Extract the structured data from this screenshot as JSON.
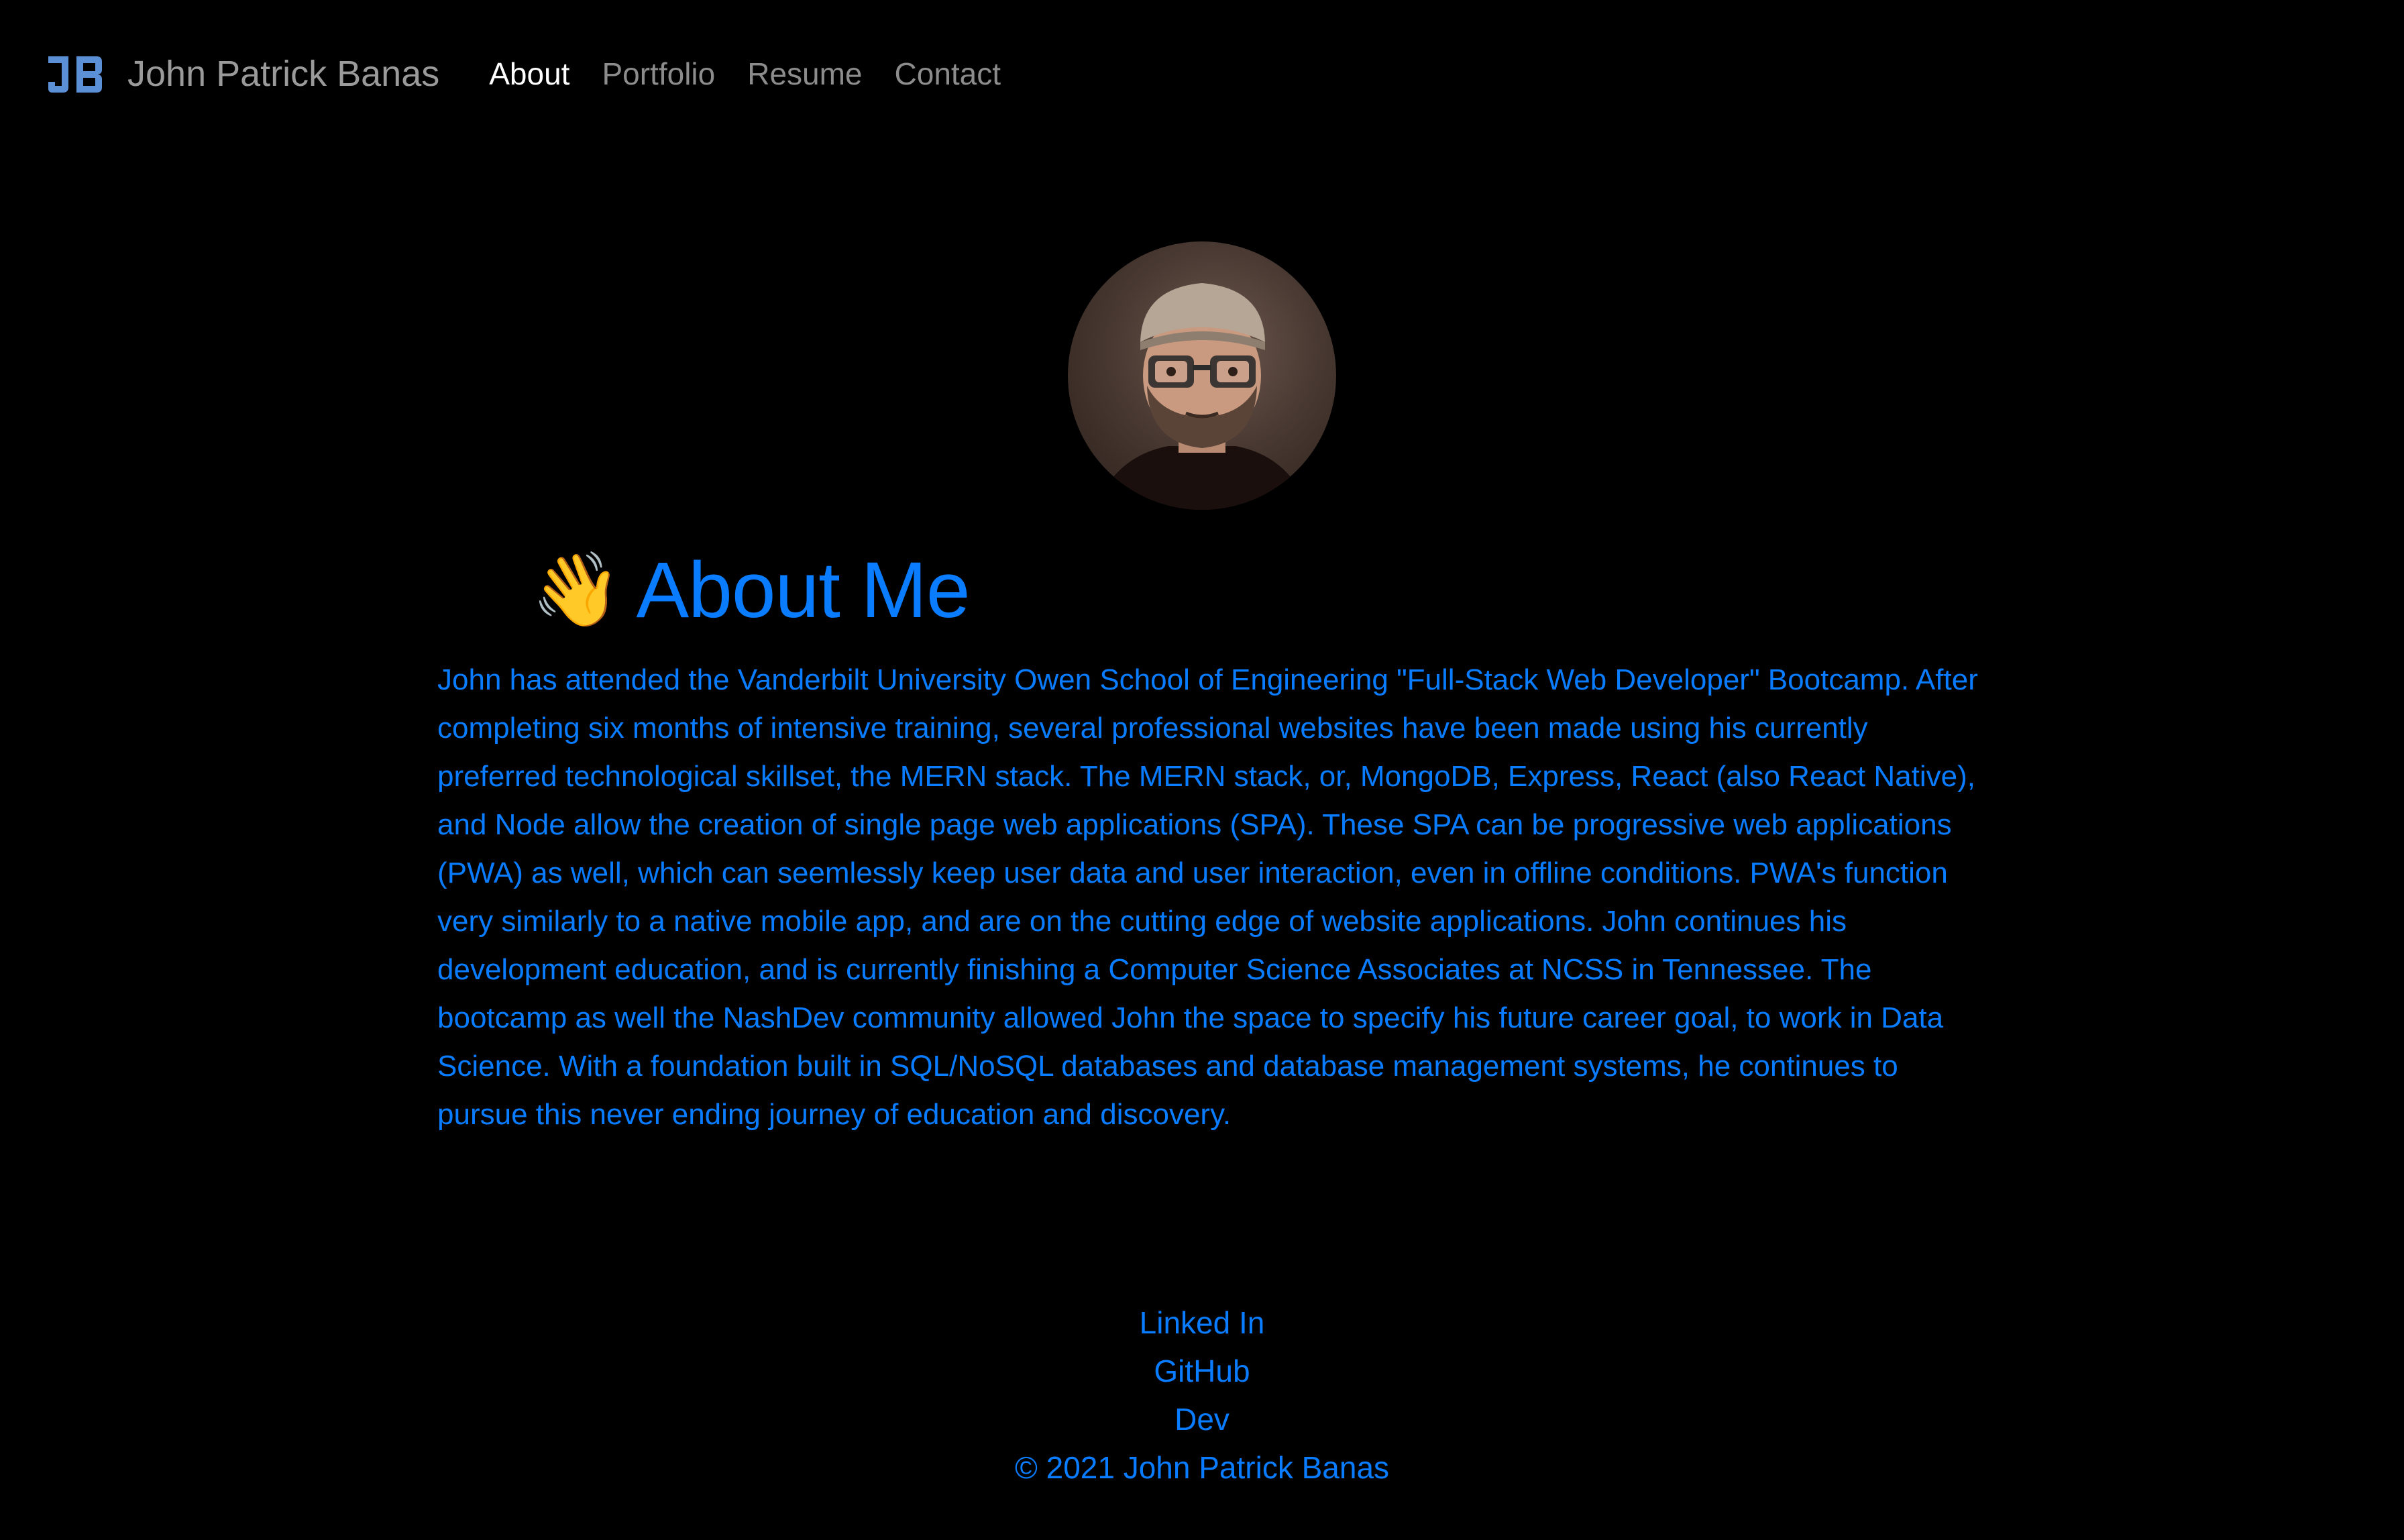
{
  "colors": {
    "background": "#000000",
    "accent": "#0a7cff",
    "nav_inactive": "#8c8c8c",
    "nav_active": "#ffffff"
  },
  "header": {
    "logo_icon": "jb-monogram-logo",
    "brand_name": "John Patrick Banas",
    "nav": [
      {
        "label": "About",
        "active": true
      },
      {
        "label": "Portfolio",
        "active": false
      },
      {
        "label": "Resume",
        "active": false
      },
      {
        "label": "Contact",
        "active": false
      }
    ]
  },
  "about": {
    "avatar_icon": "profile-photo",
    "emoji": "👋",
    "title": "About Me",
    "body": "John has attended the Vanderbilt University Owen School of Engineering \"Full-Stack Web Developer\" Bootcamp. After completing six months of intensive training, several professional websites have been made using his currently preferred technological skillset, the MERN stack. The MERN stack, or, MongoDB, Express, React (also React Native), and Node allow the creation of single page web applications (SPA). These SPA can be progressive web applications (PWA) as well, which can seemlessly keep user data and user interaction, even in offline conditions. PWA's function very similarly to a native mobile app, and are on the cutting edge of website applications. John continues his development education, and is currently finishing a Computer Science Associates at NCSS in Tennessee. The bootcamp as well the NashDev community allowed John the space to specify his future career goal, to work in Data Science. With a foundation built in SQL/NoSQL databases and database management systems, he continues to pursue this never ending journey of education and discovery."
  },
  "footer": {
    "links": [
      "Linked In",
      "GitHub",
      "Dev"
    ],
    "copyright": "© 2021 John Patrick Banas"
  }
}
